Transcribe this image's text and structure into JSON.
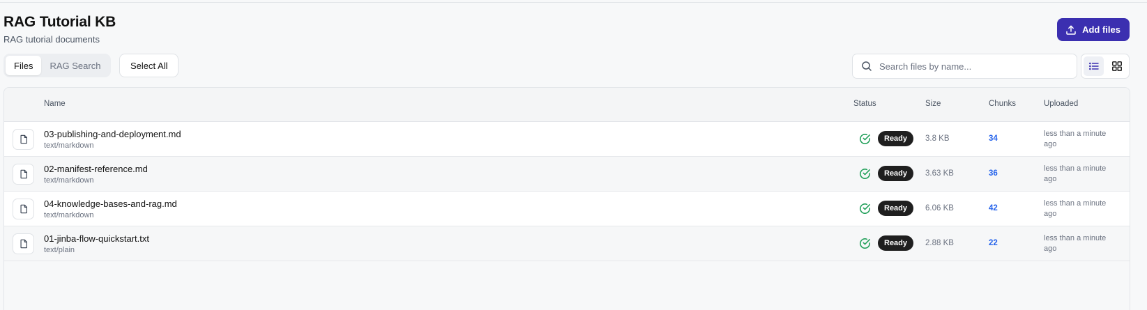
{
  "header": {
    "title": "RAG Tutorial KB",
    "subtitle": "RAG tutorial documents",
    "add_files_label": "Add files"
  },
  "toolbar": {
    "tabs": [
      {
        "label": "Files",
        "active": true
      },
      {
        "label": "RAG Search",
        "active": false
      }
    ],
    "select_all_label": "Select All",
    "search": {
      "placeholder": "Search files by name...",
      "value": ""
    },
    "view_modes": [
      {
        "icon": "list-view-icon",
        "active": true
      },
      {
        "icon": "grid-view-icon",
        "active": false
      }
    ]
  },
  "table": {
    "columns": {
      "name": "Name",
      "status": "Status",
      "size": "Size",
      "chunks": "Chunks",
      "uploaded": "Uploaded"
    },
    "rows": [
      {
        "name": "03-publishing-and-deployment.md",
        "type": "text/markdown",
        "status": "Ready",
        "size": "3.8 KB",
        "chunks": "34",
        "uploaded": "less than a minute ago"
      },
      {
        "name": "02-manifest-reference.md",
        "type": "text/markdown",
        "status": "Ready",
        "size": "3.63 KB",
        "chunks": "36",
        "uploaded": "less than a minute ago"
      },
      {
        "name": "04-knowledge-bases-and-rag.md",
        "type": "text/markdown",
        "status": "Ready",
        "size": "6.06 KB",
        "chunks": "42",
        "uploaded": "less than a minute ago"
      },
      {
        "name": "01-jinba-flow-quickstart.txt",
        "type": "text/plain",
        "status": "Ready",
        "size": "2.88 KB",
        "chunks": "22",
        "uploaded": "less than a minute ago"
      }
    ]
  },
  "colors": {
    "accent": "#3b2fb0",
    "status_ok": "#22a05a",
    "link": "#2563eb",
    "badge_bg": "#1f1f1f"
  }
}
